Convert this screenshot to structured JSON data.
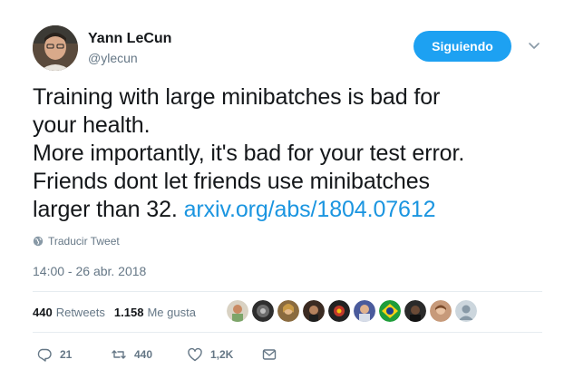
{
  "author": {
    "name": "Yann LeCun",
    "handle": "@ylecun"
  },
  "follow_button": {
    "label": "Siguiendo"
  },
  "tweet": {
    "text": "Training with large minibatches is bad for\nyour health.\nMore importantly, it's bad for your test error.\nFriends dont let friends use minibatches\nlarger than 32. ",
    "link_text": "arxiv.org/abs/1804.07612"
  },
  "translate": {
    "label": "Traducir Tweet",
    "icon": "globe-icon"
  },
  "timestamp": "14:00 - 26 abr. 2018",
  "stats": {
    "retweets_count": "440",
    "retweets_label": "Retweets",
    "likes_count": "1.158",
    "likes_label": "Me gusta",
    "liker_avatars": 10
  },
  "actions": {
    "replies": "21",
    "retweets": "440",
    "likes": "1,2K"
  },
  "colors": {
    "accent": "#1da1f2",
    "link": "#1b95e0",
    "secondary_text": "#657786"
  }
}
